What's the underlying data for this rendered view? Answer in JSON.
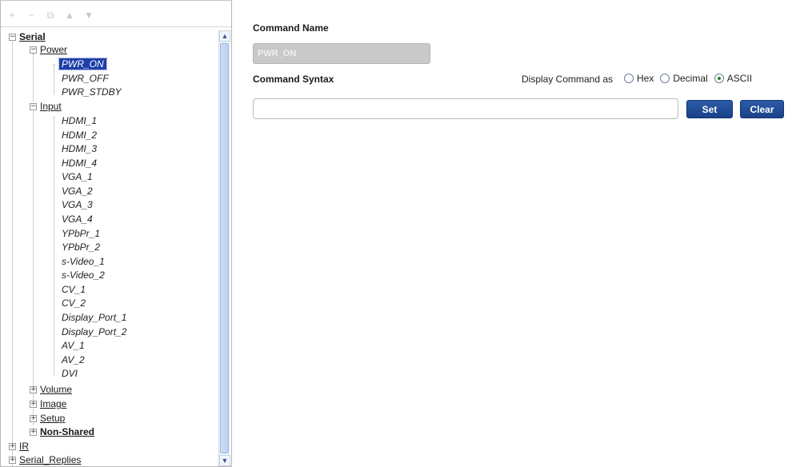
{
  "toolbar": {
    "icons": [
      "add-icon",
      "remove-icon",
      "copy-icon",
      "move-up-icon",
      "move-down-icon"
    ],
    "glyphs": [
      "+",
      "−",
      "⧉",
      "▲",
      "▼"
    ]
  },
  "tree": {
    "expand_glyph": "+",
    "collapse_glyph": "−",
    "serial": {
      "label": "Serial",
      "power": {
        "label": "Power",
        "items": [
          "PWR_ON",
          "PWR_OFF",
          "PWR_STDBY"
        ]
      },
      "input": {
        "label": "Input",
        "items": [
          "HDMI_1",
          "HDMI_2",
          "HDMI_3",
          "HDMI_4",
          "VGA_1",
          "VGA_2",
          "VGA_3",
          "VGA_4",
          "YPbPr_1",
          "YPbPr_2",
          "s-Video_1",
          "s-Video_2",
          "CV_1",
          "CV_2",
          "Display_Port_1",
          "Display_Port_2",
          "AV_1",
          "AV_2",
          "DVI"
        ]
      },
      "volume": "Volume",
      "image": "Image",
      "setup": "Setup",
      "non_shared": "Non-Shared"
    },
    "ir": "IR",
    "serial_replies": "Serial_Replies",
    "selected": "PWR_ON"
  },
  "main": {
    "command_name_label": "Command Name",
    "command_name_value": "PWR_ON",
    "command_syntax_label": "Command Syntax",
    "display_as_label": "Display Command as",
    "radios": [
      {
        "label": "Hex",
        "checked": false
      },
      {
        "label": "Decimal",
        "checked": false
      },
      {
        "label": "ASCII",
        "checked": true
      }
    ],
    "syntax_value": "",
    "set_label": "Set",
    "clear_label": "Clear"
  },
  "scrollbar": {
    "up_glyph": "▲",
    "down_glyph": "▼"
  },
  "colors": {
    "selection": "#1f3fa8",
    "button": "#1b4188",
    "radio_checked": "#2e7d32"
  }
}
